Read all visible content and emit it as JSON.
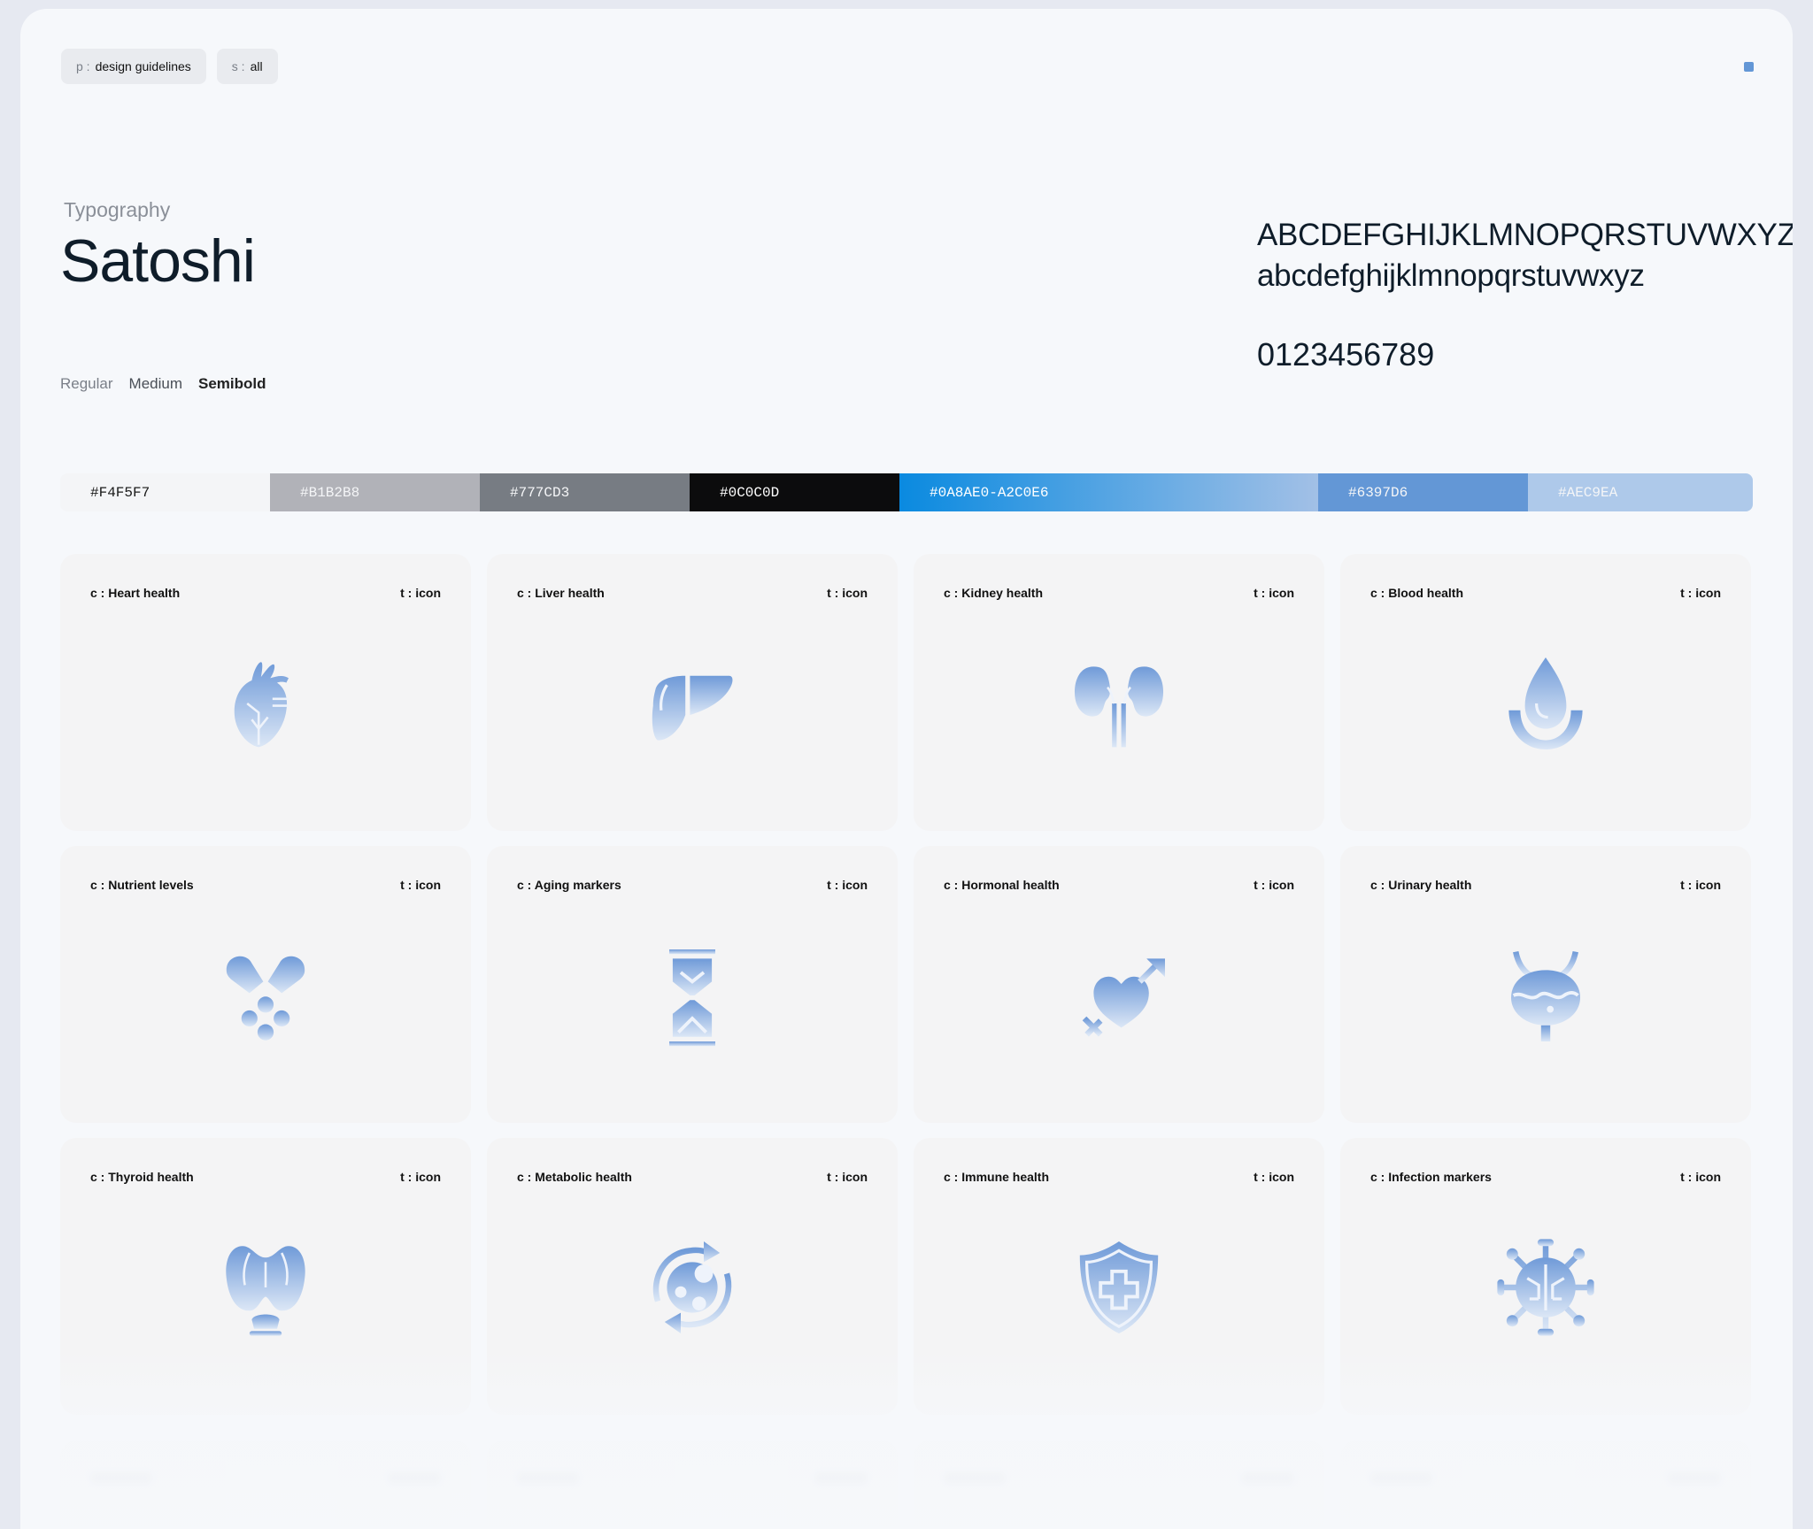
{
  "header": {
    "chips": [
      {
        "key": "p :",
        "value": "design guidelines"
      },
      {
        "key": "s :",
        "value": "all"
      }
    ]
  },
  "typography": {
    "label": "Typography",
    "font_name": "Satoshi",
    "weights": [
      "Regular",
      "Medium",
      "Semibold"
    ],
    "uppercase": "ABCDEFGHIJKLMNOPQRSTUVWXYZ",
    "lowercase": "abcdefghijklmnopqrstuvwxyz",
    "digits": "0123456789"
  },
  "palette": [
    {
      "label": "#F4F5F7",
      "bg": "#F4F5F7",
      "fg": "#1a1a1a"
    },
    {
      "label": "#B1B2B8",
      "bg": "#B1B2B8",
      "fg": "#f4f5f7"
    },
    {
      "label": "#777CD3",
      "bg": "#777C83",
      "fg": "#f4f5f7"
    },
    {
      "label": "#0C0C0D",
      "bg": "#0C0C0D",
      "fg": "#ffffff"
    },
    {
      "label": "#0A8AE0-A2C0E6",
      "bg": "linear-gradient(90deg,#0A8AE0,#A2C0E6)",
      "fg": "#ffffff"
    },
    {
      "label": "#6397D6",
      "bg": "#6397D6",
      "fg": "#f4f5f7"
    },
    {
      "label": "#AEC9EA",
      "bg": "#AEC9EA",
      "fg": "#f4f5f7"
    }
  ],
  "cards": [
    {
      "category": "c : Heart health",
      "type": "t : icon",
      "icon": "heart-organ-icon"
    },
    {
      "category": "c : Liver health",
      "type": "t : icon",
      "icon": "liver-icon"
    },
    {
      "category": "c : Kidney health",
      "type": "t : icon",
      "icon": "kidney-icon"
    },
    {
      "category": "c : Blood health",
      "type": "t : icon",
      "icon": "blood-drop-icon"
    },
    {
      "category": "c : Nutrient levels",
      "type": "t : icon",
      "icon": "capsule-icon"
    },
    {
      "category": "c : Aging markers",
      "type": "t : icon",
      "icon": "hourglass-icon"
    },
    {
      "category": "c : Hormonal health",
      "type": "t : icon",
      "icon": "gender-heart-icon"
    },
    {
      "category": "c : Urinary health",
      "type": "t : icon",
      "icon": "bladder-icon"
    },
    {
      "category": "c : Thyroid health",
      "type": "t : icon",
      "icon": "thyroid-icon"
    },
    {
      "category": "c : Metabolic health",
      "type": "t : icon",
      "icon": "metabolism-icon"
    },
    {
      "category": "c : Immune health",
      "type": "t : icon",
      "icon": "shield-cross-icon"
    },
    {
      "category": "c : Infection markers",
      "type": "t : icon",
      "icon": "virus-icon"
    }
  ],
  "colors": {
    "accent": "#6397D6",
    "icon_gradient_top": "#6397D6",
    "icon_gradient_bottom": "#DCE7F6"
  }
}
